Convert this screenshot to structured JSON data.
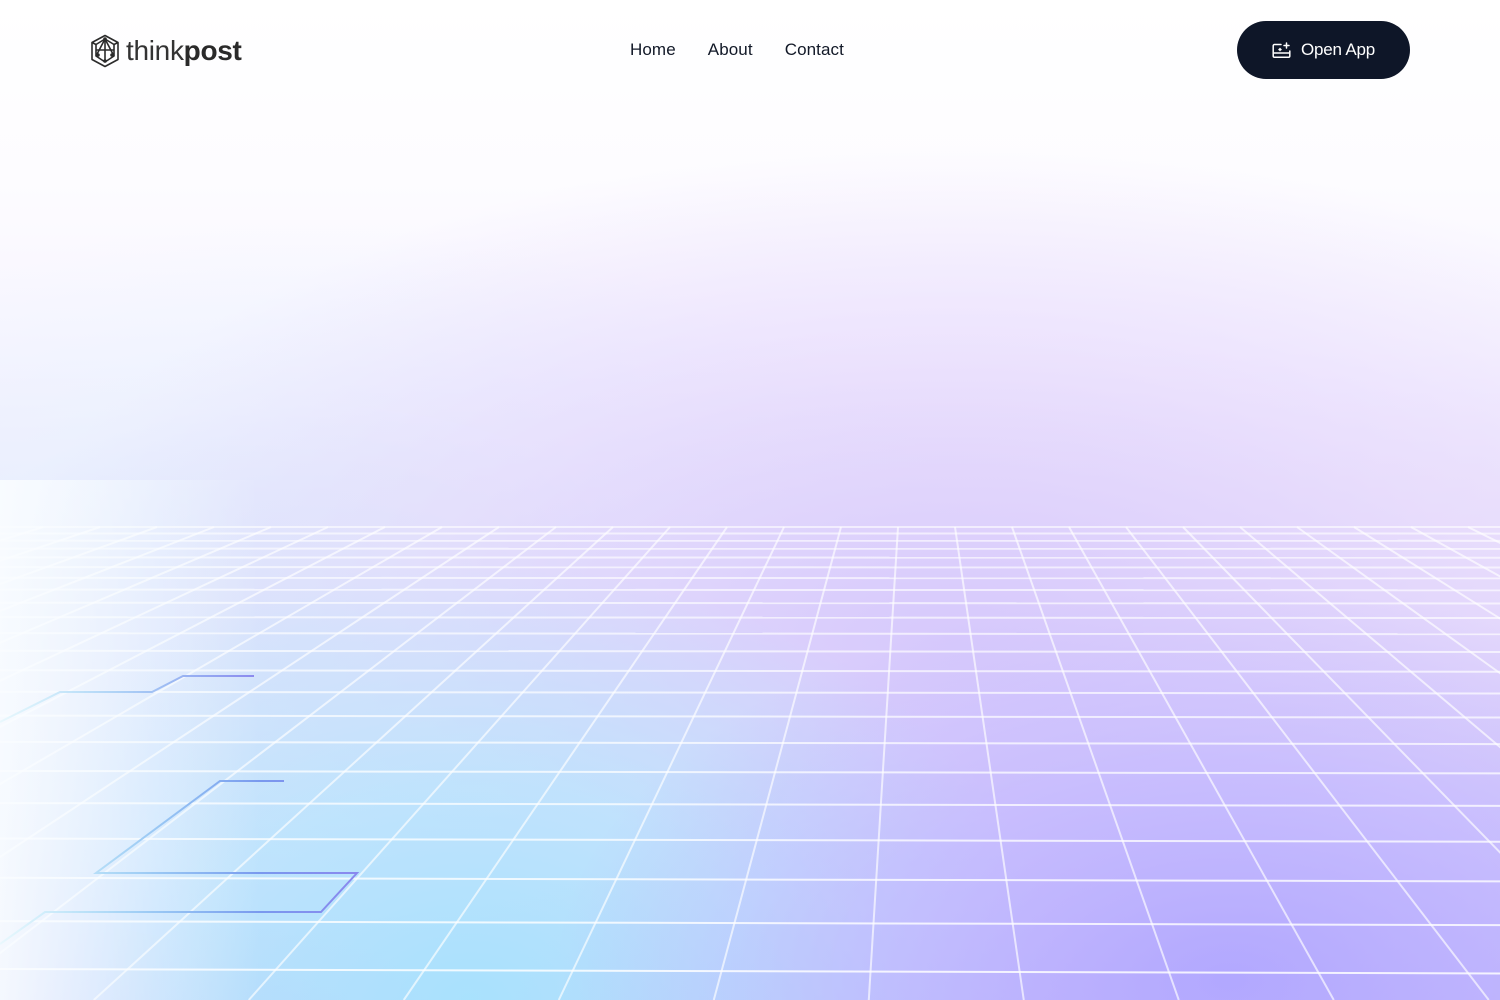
{
  "brand": {
    "name_light": "think",
    "name_bold": "post",
    "logo_icon": "geometric-dodecahedron-icon"
  },
  "nav": {
    "items": [
      {
        "label": "Home"
      },
      {
        "label": "About"
      },
      {
        "label": "Contact"
      }
    ]
  },
  "cta": {
    "label": "Open App",
    "icon": "sparkle-window-icon",
    "background": "#0e1628",
    "text_color": "#ffffff"
  },
  "theme": {
    "grid_line_color": "#ffffff",
    "trace_color_start": "#4fc3ef",
    "trace_color_end": "#8a8cf0",
    "gradient_cyan": "#a8e2fd",
    "gradient_violet": "#b0a6ff"
  }
}
